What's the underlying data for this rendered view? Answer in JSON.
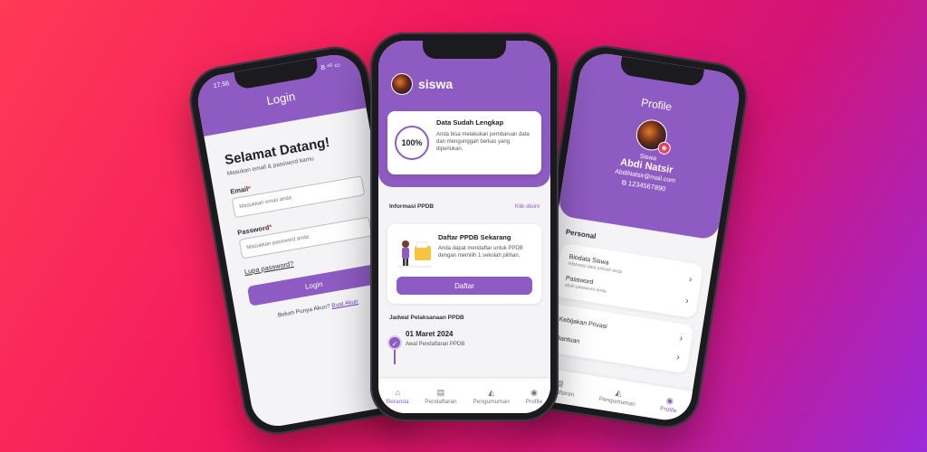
{
  "login": {
    "status_time": "17.56",
    "status_icons": "B ⁴ᴳ ▭",
    "title": "Login",
    "heading": "Selamat Datang!",
    "subheading": "Masukan email & password kamu",
    "email_label": "Email",
    "email_placeholder": "Masukkan email anda",
    "password_label": "Password",
    "password_placeholder": "Masukkan password anda",
    "required_mark": "*",
    "forgot_label": "Lupa password?",
    "login_button": "Login",
    "register_prompt": "Belum Punya Akun?",
    "register_link": "Buat Akun"
  },
  "home": {
    "username": "siswa",
    "progress_label": "100%",
    "status_title": "Data Sudah Lengkap",
    "status_desc": "Anda bisa melakukan pembaruan data dan mengunggah berkas yang diperlukan.",
    "info_label": "Informasi PPDB",
    "info_link": "Klik disini",
    "daftar_title": "Daftar PPDB Sekarang",
    "daftar_desc": "Anda dapat mendaftar untuk PPDB dengan memilih 1 sekolah pilihan.",
    "daftar_button": "Daftar",
    "schedule_title": "Jadwal Pelaksanaan PPDB",
    "schedule": [
      {
        "date": "01 Maret 2024",
        "event": "Awal Pendaftaran PPDB"
      }
    ],
    "nav": [
      {
        "label": "Beranda",
        "icon": "home-icon"
      },
      {
        "label": "Pendaftaran",
        "icon": "document-icon"
      },
      {
        "label": "Pengumuman",
        "icon": "megaphone-icon"
      },
      {
        "label": "Profile",
        "icon": "user-icon"
      }
    ]
  },
  "profile": {
    "title": "Profile",
    "role": "Siswa",
    "name": "Abdi Natsir",
    "email": "AbdiNatsir@mail.com",
    "phone": "1234567890",
    "section_personal": "Personal",
    "items": [
      {
        "title": "Biodata Siswa",
        "desc": "informasi data pribadi anda"
      },
      {
        "title": "Password",
        "desc": "ubah password anda"
      }
    ],
    "items2": [
      {
        "title": "Kebijakan Privasi"
      },
      {
        "title": "Bantuan"
      }
    ],
    "nav": [
      {
        "label": "Pendaftaran"
      },
      {
        "label": "Pengumuman"
      },
      {
        "label": "Profile"
      }
    ]
  },
  "colors": {
    "primary": "#8e5bc2",
    "background_start": "#ff3a55",
    "background_end": "#9a2ad9"
  }
}
